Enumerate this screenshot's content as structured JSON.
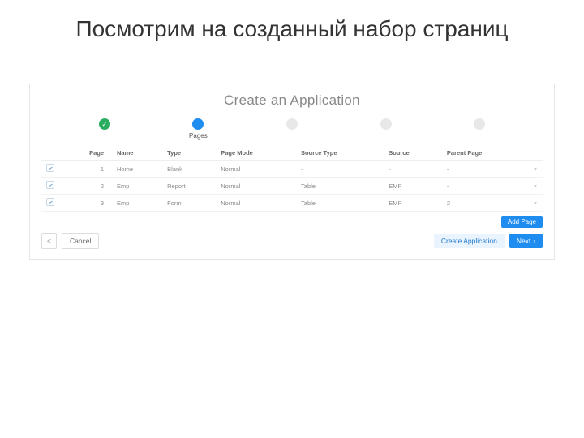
{
  "slide": {
    "title": "Посмотрим на созданный набор страниц"
  },
  "panel": {
    "title": "Create an Application"
  },
  "stepper": {
    "s0": {
      "label": "",
      "glyph": "✓"
    },
    "s1": {
      "label": "Pages",
      "glyph": ""
    },
    "s2": {
      "label": "",
      "glyph": ""
    },
    "s3": {
      "label": "",
      "glyph": ""
    },
    "s4": {
      "label": "",
      "glyph": ""
    }
  },
  "table": {
    "headers": {
      "page": "Page",
      "name": "Name",
      "type": "Type",
      "pageMode": "Page Mode",
      "sourceType": "Source Type",
      "source": "Source",
      "parentPage": "Parent Page"
    },
    "rows": [
      {
        "page": "1",
        "name": "Home",
        "type": "Blank",
        "pageMode": "Normal",
        "sourceType": "-",
        "source": "-",
        "parentPage": "-"
      },
      {
        "page": "2",
        "name": "Emp",
        "type": "Report",
        "pageMode": "Normal",
        "sourceType": "Table",
        "source": "EMP",
        "parentPage": "-"
      },
      {
        "page": "3",
        "name": "Emp",
        "type": "Form",
        "pageMode": "Normal",
        "sourceType": "Table",
        "source": "EMP",
        "parentPage": "2"
      }
    ]
  },
  "buttons": {
    "addPage": "Add Page",
    "prev": "<",
    "cancel": "Cancel",
    "createApp": "Create Application",
    "next": "Next",
    "nextIcon": "›"
  },
  "icons": {
    "delete": "×"
  }
}
